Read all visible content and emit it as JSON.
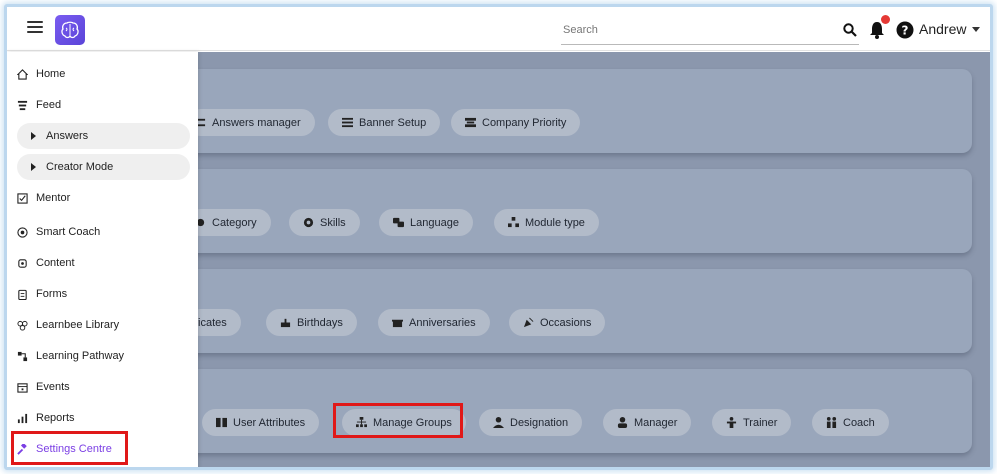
{
  "header": {
    "search_placeholder": "Search",
    "user_name": "Andrew"
  },
  "sidebar": {
    "items": [
      {
        "label": "Home"
      },
      {
        "label": "Feed"
      },
      {
        "label": "Answers"
      },
      {
        "label": "Creator Mode"
      },
      {
        "label": "Mentor"
      },
      {
        "label": "Smart Coach"
      },
      {
        "label": "Content"
      },
      {
        "label": "Forms"
      },
      {
        "label": "Learnbee Library"
      },
      {
        "label": "Learning Pathway"
      },
      {
        "label": "Events"
      },
      {
        "label": "Reports"
      },
      {
        "label": "Settings Centre"
      }
    ]
  },
  "main": {
    "cards": [
      {
        "chips": [
          "Answers manager",
          "Banner Setup",
          "Company Priority"
        ]
      },
      {
        "chips": [
          "Category",
          "Skills",
          "Language",
          "Module type"
        ]
      },
      {
        "chips": [
          "ficates",
          "Birthdays",
          "Anniversaries",
          "Occasions"
        ]
      },
      {
        "chips": [
          "User Attributes",
          "Manage Groups",
          "Designation",
          "Manager",
          "Trainer",
          "Coach"
        ]
      }
    ]
  },
  "colors": {
    "accent": "#7b3fe4",
    "highlight": "#e01818",
    "overlay": "#8b97ad",
    "notification_dot": "#e53935"
  }
}
